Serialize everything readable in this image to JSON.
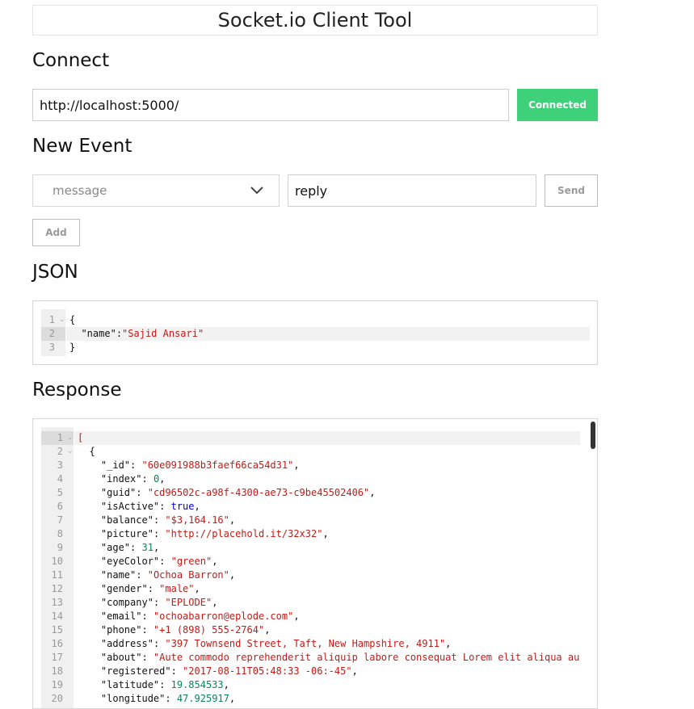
{
  "app": {
    "title": "Socket.io Client Tool"
  },
  "connect": {
    "heading": "Connect",
    "url": "http://localhost:5000/",
    "status_button": "Connected",
    "status_color": "#3fd07a"
  },
  "new_event": {
    "heading": "New Event",
    "event_select": "message",
    "reply_value": "reply",
    "send_label": "Send",
    "add_label": "Add"
  },
  "json_section": {
    "heading": "JSON",
    "lines": [
      [
        [
          "p",
          "{"
        ]
      ],
      [
        [
          "p",
          "  "
        ],
        [
          "k",
          "\"name\""
        ],
        [
          "p",
          ":"
        ],
        [
          "s",
          "\"Sajid Ansari\""
        ]
      ],
      [
        [
          "p",
          "}"
        ]
      ]
    ],
    "active_line": 2
  },
  "response_section": {
    "heading": "Response",
    "lines": [
      [
        [
          "s",
          "["
        ]
      ],
      [
        [
          "p",
          "  {"
        ]
      ],
      [
        [
          "p",
          "    "
        ],
        [
          "k",
          "\"_id\""
        ],
        [
          "p",
          ": "
        ],
        [
          "s",
          "\"60e091988b3faef66ca54d31\""
        ],
        [
          "p",
          ","
        ]
      ],
      [
        [
          "p",
          "    "
        ],
        [
          "k",
          "\"index\""
        ],
        [
          "p",
          ": "
        ],
        [
          "n",
          "0"
        ],
        [
          "p",
          ","
        ]
      ],
      [
        [
          "p",
          "    "
        ],
        [
          "k",
          "\"guid\""
        ],
        [
          "p",
          ": "
        ],
        [
          "s",
          "\"cd96502c-a98f-4300-ae73-c9be45502406\""
        ],
        [
          "p",
          ","
        ]
      ],
      [
        [
          "p",
          "    "
        ],
        [
          "k",
          "\"isActive\""
        ],
        [
          "p",
          ": "
        ],
        [
          "b",
          "true"
        ],
        [
          "p",
          ","
        ]
      ],
      [
        [
          "p",
          "    "
        ],
        [
          "k",
          "\"balance\""
        ],
        [
          "p",
          ": "
        ],
        [
          "s",
          "\"$3,164.16\""
        ],
        [
          "p",
          ","
        ]
      ],
      [
        [
          "p",
          "    "
        ],
        [
          "k",
          "\"picture\""
        ],
        [
          "p",
          ": "
        ],
        [
          "s",
          "\"http://placehold.it/32x32\""
        ],
        [
          "p",
          ","
        ]
      ],
      [
        [
          "p",
          "    "
        ],
        [
          "k",
          "\"age\""
        ],
        [
          "p",
          ": "
        ],
        [
          "n",
          "31"
        ],
        [
          "p",
          ","
        ]
      ],
      [
        [
          "p",
          "    "
        ],
        [
          "k",
          "\"eyeColor\""
        ],
        [
          "p",
          ": "
        ],
        [
          "s",
          "\"green\""
        ],
        [
          "p",
          ","
        ]
      ],
      [
        [
          "p",
          "    "
        ],
        [
          "k",
          "\"name\""
        ],
        [
          "p",
          ": "
        ],
        [
          "s",
          "\"Ochoa Barron\""
        ],
        [
          "p",
          ","
        ]
      ],
      [
        [
          "p",
          "    "
        ],
        [
          "k",
          "\"gender\""
        ],
        [
          "p",
          ": "
        ],
        [
          "s",
          "\"male\""
        ],
        [
          "p",
          ","
        ]
      ],
      [
        [
          "p",
          "    "
        ],
        [
          "k",
          "\"company\""
        ],
        [
          "p",
          ": "
        ],
        [
          "s",
          "\"EPLODE\""
        ],
        [
          "p",
          ","
        ]
      ],
      [
        [
          "p",
          "    "
        ],
        [
          "k",
          "\"email\""
        ],
        [
          "p",
          ": "
        ],
        [
          "s",
          "\"ochoabarron@eplode.com\""
        ],
        [
          "p",
          ","
        ]
      ],
      [
        [
          "p",
          "    "
        ],
        [
          "k",
          "\"phone\""
        ],
        [
          "p",
          ": "
        ],
        [
          "s",
          "\"+1 (898) 555-2764\""
        ],
        [
          "p",
          ","
        ]
      ],
      [
        [
          "p",
          "    "
        ],
        [
          "k",
          "\"address\""
        ],
        [
          "p",
          ": "
        ],
        [
          "s",
          "\"397 Townsend Street, Taft, New Hampshire, 4911\""
        ],
        [
          "p",
          ","
        ]
      ],
      [
        [
          "p",
          "    "
        ],
        [
          "k",
          "\"about\""
        ],
        [
          "p",
          ": "
        ],
        [
          "s",
          "\"Aute commodo reprehenderit aliquip labore consequat Lorem elit aliqua au"
        ]
      ],
      [
        [
          "p",
          "    "
        ],
        [
          "k",
          "\"registered\""
        ],
        [
          "p",
          ": "
        ],
        [
          "s",
          "\"2017-08-11T05:48:33 -06:-45\""
        ],
        [
          "p",
          ","
        ]
      ],
      [
        [
          "p",
          "    "
        ],
        [
          "k",
          "\"latitude\""
        ],
        [
          "p",
          ": "
        ],
        [
          "n",
          "19.854533"
        ],
        [
          "p",
          ","
        ]
      ],
      [
        [
          "p",
          "    "
        ],
        [
          "k",
          "\"longitude\""
        ],
        [
          "p",
          ": "
        ],
        [
          "n",
          "47.925917"
        ],
        [
          "p",
          ","
        ]
      ]
    ],
    "active_line": 1
  }
}
